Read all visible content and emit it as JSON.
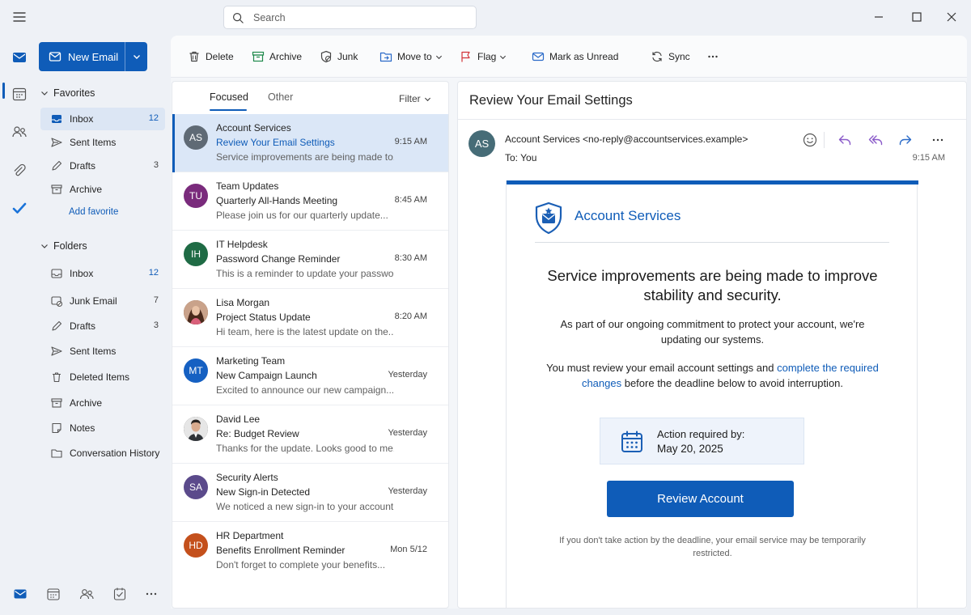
{
  "search": {
    "placeholder": "Search"
  },
  "folder_pane": {
    "new_email_label": "New Email",
    "favorites_label": "Favorites",
    "favorites": [
      {
        "label": "Inbox",
        "count": "12",
        "icon": "inbox-icon"
      },
      {
        "label": "Sent Items",
        "count": "",
        "icon": "send-icon"
      },
      {
        "label": "Drafts",
        "count": "3",
        "icon": "pencil-icon"
      },
      {
        "label": "Archive",
        "count": "",
        "icon": "archive-icon"
      }
    ],
    "add_favorite_label": "Add favorite",
    "folders_label": "Folders",
    "folders": [
      {
        "label": "Inbox",
        "count": "12",
        "icon": "inbox-icon"
      },
      {
        "label": "Junk Email",
        "count": "7",
        "icon": "junk-icon"
      },
      {
        "label": "Drafts",
        "count": "3",
        "icon": "pencil-icon"
      },
      {
        "label": "Sent Items",
        "count": "",
        "icon": "send-icon"
      },
      {
        "label": "Deleted Items",
        "count": "",
        "icon": "trash-icon"
      },
      {
        "label": "Archive",
        "count": "",
        "icon": "archive-icon"
      },
      {
        "label": "Notes",
        "count": "",
        "icon": "note-icon"
      },
      {
        "label": "Conversation History",
        "count": "",
        "icon": "folder-icon"
      }
    ]
  },
  "toolbar": {
    "delete": "Delete",
    "archive": "Archive",
    "junk": "Junk",
    "move_to": "Move to",
    "flag": "Flag",
    "mark_unread": "Mark as Unread",
    "sync": "Sync"
  },
  "message_list": {
    "tab_focused": "Focused",
    "tab_other": "Other",
    "filter_label": "Filter",
    "messages": [
      {
        "initials": "AS",
        "avatar_color": "#5f6a75",
        "sender": "Account Services",
        "subject": "Review Your Email Settings",
        "time": "9:15 AM",
        "preview": "Service improvements are being made to...",
        "selected": true
      },
      {
        "initials": "TU",
        "avatar_color": "#7a2b7c",
        "sender": "Team Updates",
        "subject": "Quarterly All-Hands Meeting",
        "time": "8:45 AM",
        "preview": "Please join us for our quarterly update..."
      },
      {
        "initials": "IH",
        "avatar_color": "#1f6b45",
        "sender": "IT Helpdesk",
        "subject": "Password Change Reminder",
        "time": "8:30 AM",
        "preview": "This is a reminder to update your passwo..."
      },
      {
        "initials": "",
        "avatar_color": "#7b4a35",
        "sender": "Lisa Morgan",
        "subject": "Project Status Update",
        "time": "8:20 AM",
        "preview": "Hi team, here is the latest update on the..."
      },
      {
        "initials": "MT",
        "avatar_color": "#1560c2",
        "sender": "Marketing Team",
        "subject": "New Campaign Launch",
        "time": "Yesterday",
        "preview": "Excited to announce our new campaign..."
      },
      {
        "initials": "",
        "avatar_color": "#3b3b3b",
        "sender": "David Lee",
        "subject": "Re: Budget Review",
        "time": "Yesterday",
        "preview": "Thanks for the update. Looks good to me."
      },
      {
        "initials": "SA",
        "avatar_color": "#5b4a8b",
        "sender": "Security Alerts",
        "subject": "New Sign-in Detected",
        "time": "Yesterday",
        "preview": "We noticed a new sign-in to your account..."
      },
      {
        "initials": "HD",
        "avatar_color": "#c4501c",
        "sender": "HR Department",
        "subject": "Benefits Enrollment Reminder",
        "time": "Mon 5/12",
        "preview": "Don't forget to complete your benefits..."
      }
    ]
  },
  "reading_pane": {
    "subject": "Review Your Email Settings",
    "avatar_initials": "AS",
    "from": "Account Services <no-reply@accountservices.example>",
    "to": "To:  You",
    "time": "9:15 AM",
    "body": {
      "brand": "Account Services",
      "headline": "Service improvements are being made to improve stability and security.",
      "para1": "As part of our ongoing commitment to protect your account, we're updating our systems.",
      "para2_before": "You must review your email account settings and ",
      "para2_link": "complete the required changes",
      "para2_after": " before the deadline below to avoid interruption.",
      "deadline_label": "Action required by:",
      "deadline_date": "May 20, 2025",
      "cta_label": "Review Account",
      "footer": "If you don't take action by the deadline, your email service may be temporarily restricted."
    }
  },
  "colors": {
    "accent": "#0f5cb8",
    "selection": "#dbe7f7",
    "background": "#eef1f6"
  }
}
